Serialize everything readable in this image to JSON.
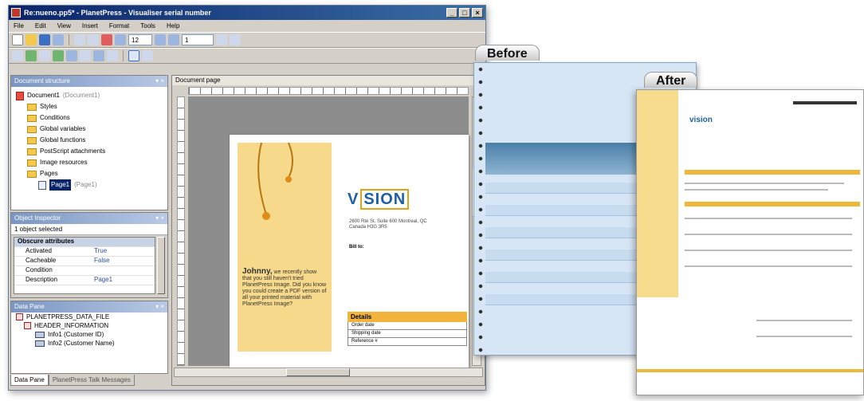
{
  "window": {
    "title": "Re:nueno.pp5* - PlanetPress - Visualiser serial number",
    "controls": [
      "_",
      "□",
      "×"
    ]
  },
  "menu": [
    "File",
    "Edit",
    "View",
    "Insert",
    "Format",
    "Tools",
    "Help"
  ],
  "toolbar": {
    "zoom_value": "12",
    "page_value": "1"
  },
  "doc_structure": {
    "title": "Document structure",
    "items": [
      {
        "label": "Document1",
        "suffix": "(Document1)"
      },
      {
        "label": "Styles"
      },
      {
        "label": "Conditions"
      },
      {
        "label": "Global variables"
      },
      {
        "label": "Global functions"
      },
      {
        "label": "PostScript attachments"
      },
      {
        "label": "Image resources"
      },
      {
        "label": "Pages"
      },
      {
        "label": "Page1",
        "suffix": "(Page1)"
      }
    ]
  },
  "object_inspector": {
    "title": "Object Inspector",
    "selected": "1 object selected",
    "group": "Obscure attributes",
    "rows": [
      {
        "key": "Activated",
        "val": "True"
      },
      {
        "key": "Cacheable",
        "val": "False"
      },
      {
        "key": "Condition",
        "val": ""
      },
      {
        "key": "Description",
        "val": "Page1"
      }
    ]
  },
  "data_pane": {
    "title": "Data Pane",
    "rows": [
      "PLANETPRESS_DATA_FILE",
      "HEADER_INFORMATION",
      "Info1 (Customer ID)",
      "Info2 (Customer Name)"
    ],
    "tabs": [
      "Data Pane",
      "PlanetPress Talk Messages"
    ]
  },
  "doc_page": {
    "title": "Document page",
    "promo_head": "Johnny,",
    "promo_body": "we recently show that you still haven't tried PlanetPress Image. Did you know you could create a PDF version of all your printed material with PlanetPress Image?",
    "logo_left": "V",
    "logo_right": "SION",
    "address": "2600 Rte St. Suite 600 Montreal, QC Canada H3G 3R5",
    "bill_to": "Bill to:",
    "details_head": "Details",
    "details_rows": [
      "Order date",
      "Shipping date",
      "Reference #"
    ]
  },
  "before_label": "Before",
  "after_label": "After",
  "after_logo": "vision"
}
